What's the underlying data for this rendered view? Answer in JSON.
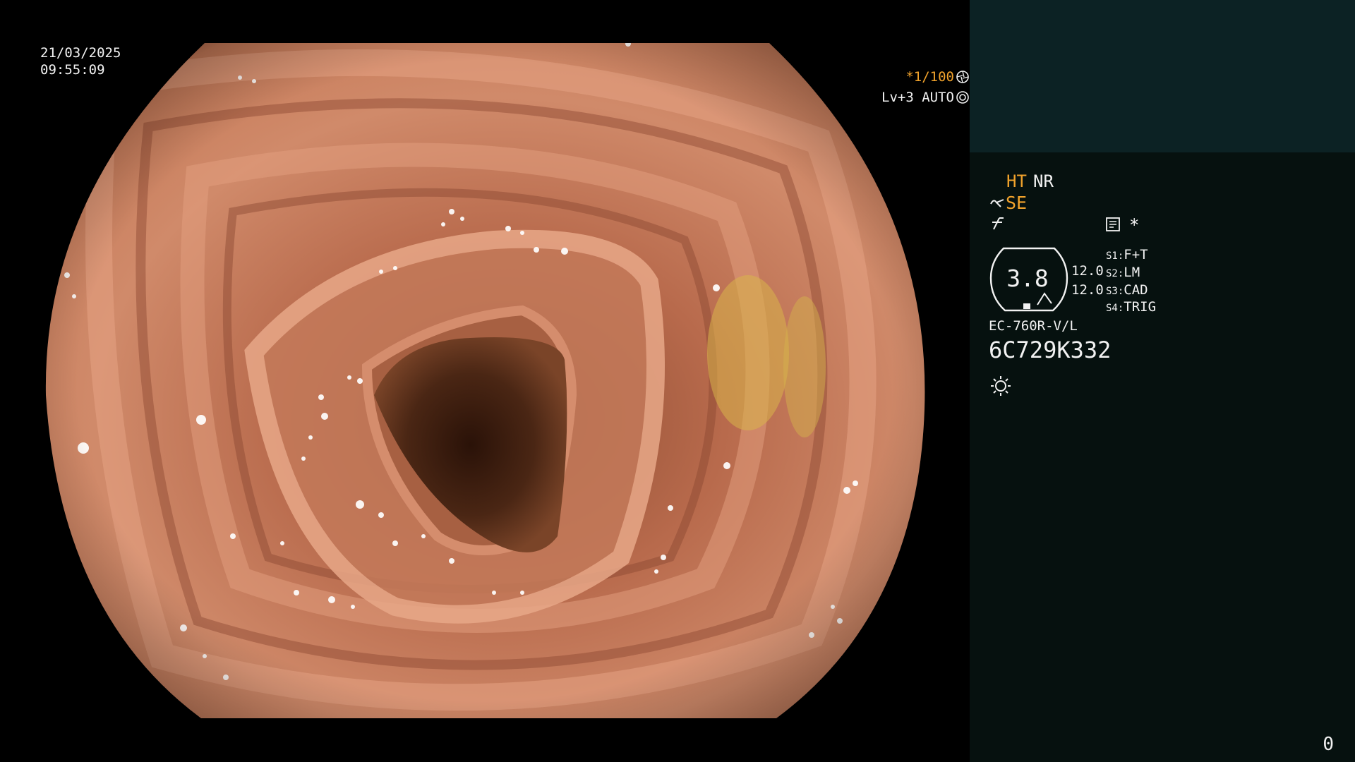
{
  "overlay": {
    "date": "21/03/2025",
    "time": "09:55:09",
    "shutter_speed": "*1/100",
    "shutter_icon": "aperture-icon",
    "exposure": "Lv+3 AUTO",
    "exposure_icon": "iris-auto-icon"
  },
  "panel": {
    "ht_label": "HT",
    "nr_label": "NR",
    "se_label": "SE",
    "se_icon": "structure-enhance-icon",
    "freeze_icon": "freeze-icon",
    "memo_icon": "memo-icon",
    "star": "*",
    "zoom_value": "3.8",
    "zoom_sub1": "12.0",
    "zoom_sub2": "12.0",
    "switches": [
      {
        "key": "S1:",
        "value": "F+T"
      },
      {
        "key": "S2:",
        "value": "LM"
      },
      {
        "key": "S3:",
        "value": "CAD"
      },
      {
        "key": "S4:",
        "value": "TRIG"
      }
    ],
    "scope_model": "EC-760R-V/L",
    "scope_serial": "6C729K332",
    "light_icon": "light-source-icon",
    "image_counter": "0"
  },
  "colors": {
    "accent_orange": "#f2a32c",
    "text_white": "#f2f2f2",
    "panel_bg": "#06110f",
    "thumb_bg": "#0c2224"
  }
}
